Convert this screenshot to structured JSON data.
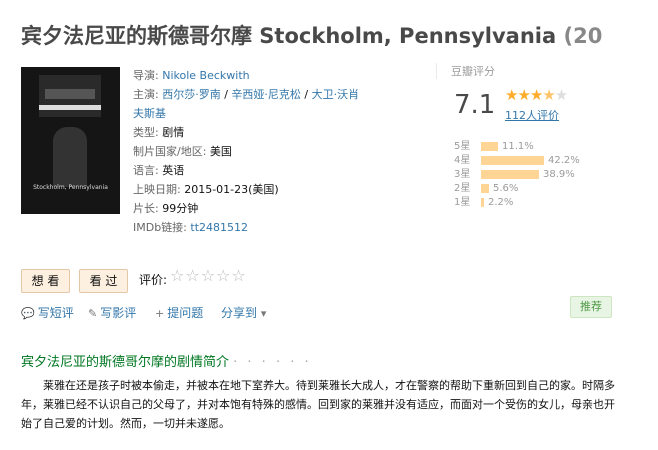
{
  "title": {
    "main": "宾夕法尼亚的斯德哥尔摩 Stockholm, Pennsylvania",
    "year": "(20"
  },
  "poster": {
    "title": "Stockholm, Pennsylvania"
  },
  "info": {
    "director_label": "导演:",
    "director": "Nikole Beckwith",
    "cast_label": "主演:",
    "cast": [
      "西尔莎·罗南",
      "辛西娅·尼克松",
      "大卫·沃肖",
      "夫斯基"
    ],
    "genre_label": "类型:",
    "genre": "剧情",
    "country_label": "制片国家/地区:",
    "country": "美国",
    "language_label": "语言:",
    "language": "英语",
    "release_label": "上映日期:",
    "release": "2015-01-23(美国)",
    "runtime_label": "片长:",
    "runtime": "99分钟",
    "imdb_label": "IMDb链接:",
    "imdb": "tt2481512"
  },
  "rating": {
    "title": "豆瓣评分",
    "score": "7.1",
    "stars_value": 3.5,
    "count": "112人评价",
    "breakdown": [
      {
        "label": "5星",
        "value": 11.1,
        "text": "11.1%"
      },
      {
        "label": "4星",
        "value": 42.2,
        "text": "42.2%"
      },
      {
        "label": "3星",
        "value": 38.9,
        "text": "38.9%"
      },
      {
        "label": "2星",
        "value": 5.6,
        "text": "5.6%"
      },
      {
        "label": "1星",
        "value": 2.2,
        "text": "2.2%"
      }
    ]
  },
  "buttons": {
    "want": "想 看",
    "seen": "看 过",
    "rate_label": "评价:",
    "rate_stars": "☆☆☆☆☆"
  },
  "actions": {
    "short_review": "写短评",
    "review": "写影评",
    "question": "提问题",
    "share": "分享到",
    "recommend": "推荐"
  },
  "synopsis": {
    "heading": "宾夕法尼亚的斯德哥尔摩的剧情简介",
    "dots": "· · · · · ·",
    "text": "莱雅在还是孩子时被本偷走，并被本在地下室养大。待到莱雅长大成人，才在警察的帮助下重新回到自己的家。时隔多年，莱雅已经不认识自己的父母了，并对本饱有特殊的感情。回到家的莱雅并没有适应，而面对一个受伤的女儿，母亲也开始了自己爱的计划。然而，一切并未遂愿。"
  }
}
